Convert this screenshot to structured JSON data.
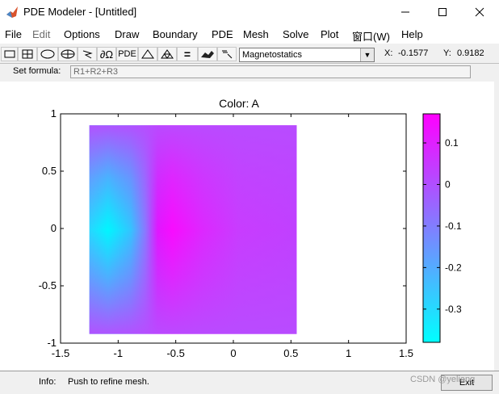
{
  "window": {
    "title": "PDE Modeler - [Untitled]",
    "controls": [
      "minimize-icon",
      "maximize-icon",
      "close-icon"
    ]
  },
  "menu": [
    "File",
    "Edit",
    "Options",
    "Draw",
    "Boundary",
    "PDE",
    "Mesh",
    "Solve",
    "Plot",
    "窗口(W)",
    "Help"
  ],
  "toolbar": {
    "buttons": [
      "rectangle-icon",
      "rectangle-center-icon",
      "ellipse-icon",
      "ellipse-center-icon",
      "polygon-icon",
      "boundary-icon",
      "pde-icon",
      "init-mesh-icon",
      "refine-mesh-icon",
      "solve-icon",
      "plot-icon",
      "zoom-icon"
    ],
    "boundary_label": "∂Ω",
    "pde_label": "PDE",
    "solve_label": "=",
    "application": "Magnetostatics",
    "x_label": "X:",
    "x_value": "-0.1577",
    "y_label": "Y:",
    "y_value": "0.9182"
  },
  "formula": {
    "label": "Set formula:",
    "value": "R1+R2+R3"
  },
  "plot": {
    "title": "Color: A",
    "colors": {
      "low": "#00ffff",
      "high": "#ff00ff",
      "mid": "#b84cff"
    }
  },
  "chart_data": {
    "type": "heatmap",
    "title": "Color: A",
    "xlabel": "",
    "ylabel": "",
    "xlim": [
      -1.5,
      1.5
    ],
    "ylim": [
      -1,
      1
    ],
    "xticks": [
      -1.5,
      -1,
      -0.5,
      0,
      0.5,
      1,
      1.5
    ],
    "xtick_labels": [
      "-1.5",
      "-1",
      "-0.5",
      "0",
      "0.5",
      "1",
      "1.5"
    ],
    "yticks": [
      -1,
      -0.5,
      0,
      0.5,
      1
    ],
    "ytick_labels": [
      "-1",
      "-0.5",
      "0",
      "0.5",
      "1"
    ],
    "domain": {
      "x": [
        -1.25,
        0.55
      ],
      "y": [
        -0.92,
        0.9
      ]
    },
    "colorbar": {
      "range": [
        -0.38,
        0.17
      ],
      "ticks": [
        0.1,
        0,
        -0.1,
        -0.2,
        -0.3
      ],
      "tick_labels": [
        "0.1",
        "0",
        "-0.1",
        "-0.2",
        "-0.3"
      ],
      "colormap": "cool"
    },
    "grid": false
  },
  "status": {
    "label": "Info:",
    "text": "Push to refine mesh.",
    "exit_label": "Exit"
  },
  "watermark": "CSDN @yeliang"
}
